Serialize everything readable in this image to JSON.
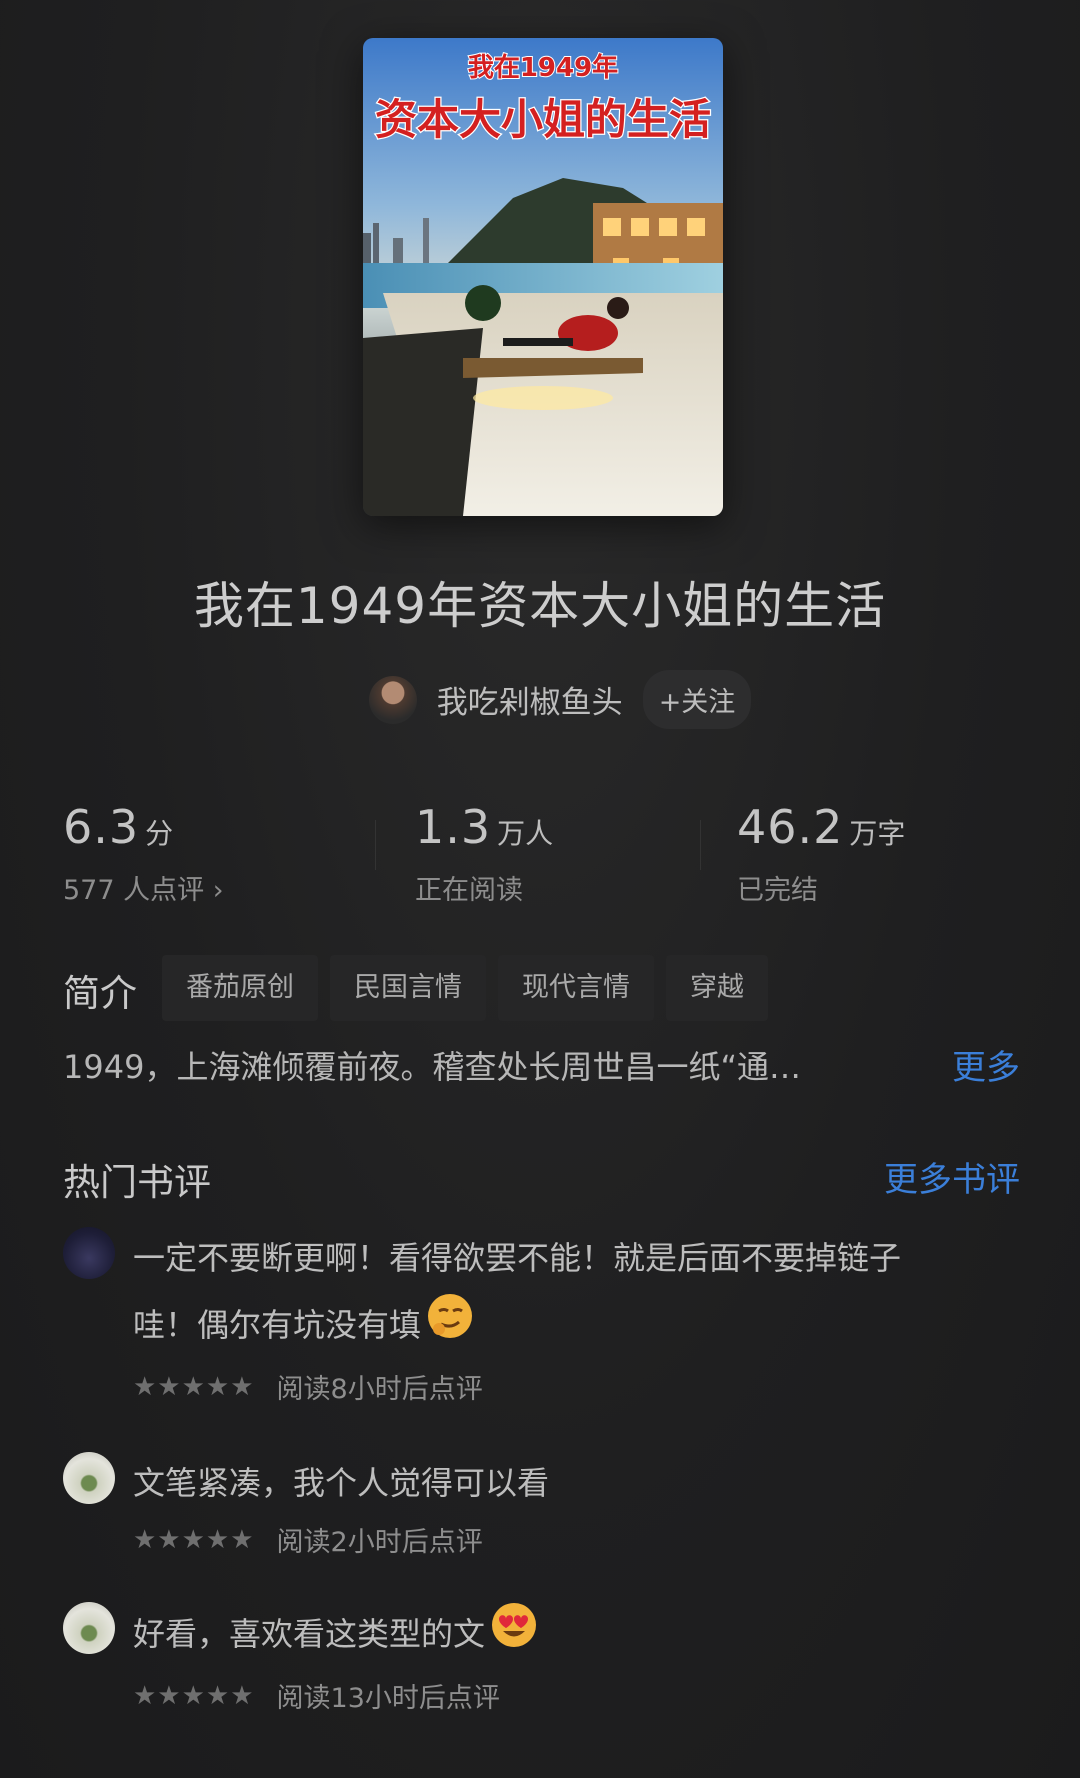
{
  "book": {
    "cover_line1": "我在1949年",
    "cover_line2": "资本大小姐的生活",
    "title": "我在1949年资本大小姐的生活",
    "author": "我吃剁椒鱼头",
    "follow_label": "+关注"
  },
  "stats": {
    "rating": {
      "value": "6.3",
      "unit": "分",
      "sub": "577 人点评 ›"
    },
    "readers": {
      "value": "1.3",
      "unit": "万人",
      "sub": "正在阅读"
    },
    "words": {
      "value": "46.2",
      "unit": "万字",
      "sub": "已完结"
    }
  },
  "intro": {
    "label": "简介",
    "tags": [
      "番茄原创",
      "民国言情",
      "现代言情",
      "穿越"
    ],
    "text": "1949，上海滩倾覆前夜。稽查处长周世昌一纸“通…",
    "more": "更多"
  },
  "reviews_section": {
    "title": "热门书评",
    "more": "更多书评",
    "items": [
      {
        "text_line1": "一定不要断更啊！看得欲罢不能！就是后面不要掉链子",
        "text_line2": "哇！偶尔有坑没有填",
        "emoji": "smirk-face",
        "stars": "★★★★★",
        "time": "阅读8小时后点评"
      },
      {
        "text_line1": "文笔紧凑，我个人觉得可以看",
        "stars": "★★★★★",
        "time": "阅读2小时后点评"
      },
      {
        "text_line1": "好看，喜欢看这类型的文",
        "emoji": "heart-eyes-face",
        "stars": "★★★★★",
        "time": "阅读13小时后点评"
      }
    ]
  },
  "colors": {
    "background": "#1f1f20",
    "accent": "#3b7fd9",
    "cover_title": "#d42020"
  }
}
